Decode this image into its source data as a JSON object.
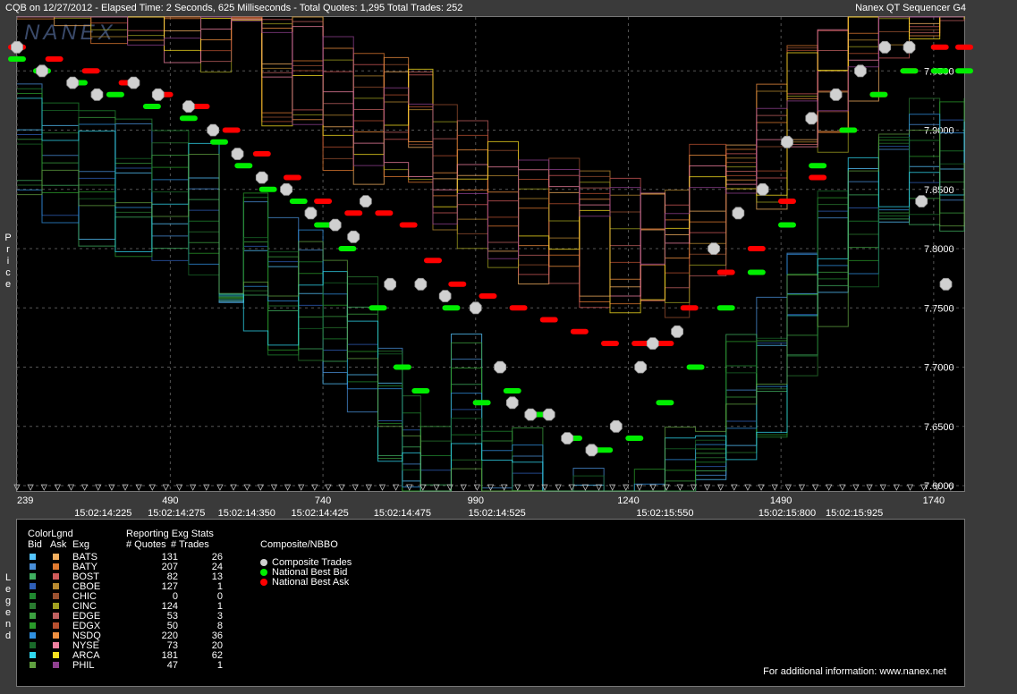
{
  "header": {
    "left": "CQB on 12/27/2012  -  Elapsed Time: 2 Seconds, 625 Milliseconds  -  Total Quotes: 1,295  Total Trades: 252",
    "right": "Nanex QT Sequencer G4"
  },
  "watermark": "NANEX",
  "side_labels": {
    "price": "Price",
    "legend": "Legend"
  },
  "chart_data": {
    "type": "scatter",
    "ylabel": "Price",
    "ylim": [
      7.5955,
      7.9955
    ],
    "xlim": [
      239,
      1790
    ],
    "y_ticks": [
      7.6,
      7.65,
      7.7,
      7.75,
      7.8,
      7.85,
      7.9,
      7.95
    ],
    "y_tick_labels": [
      "7.6000",
      "7.6500",
      "7.7000",
      "7.7500",
      "7.8000",
      "7.8500",
      "7.9000",
      "7.9500"
    ],
    "x_ticks": [
      239,
      490,
      740,
      990,
      1240,
      1490,
      1740
    ],
    "x_tick_labels": [
      "239",
      "490",
      "740",
      "990",
      "1240",
      "1490",
      "1740"
    ],
    "time_labels": [
      {
        "x": 380,
        "label": "15:02:14:225"
      },
      {
        "x": 500,
        "label": "15:02:14:275"
      },
      {
        "x": 615,
        "label": "15:02:14:350"
      },
      {
        "x": 735,
        "label": "15:02:14:425"
      },
      {
        "x": 870,
        "label": "15:02:14:475"
      },
      {
        "x": 1025,
        "label": "15:02:14:525"
      },
      {
        "x": 1300,
        "label": "15:02:15:550"
      },
      {
        "x": 1500,
        "label": "15:02:15:800"
      },
      {
        "x": 1610,
        "label": "15:02:15:925"
      }
    ],
    "grid": true,
    "series": [
      {
        "name": "Composite Trades",
        "color": "#d0d0d0",
        "x": [
          239,
          280,
          330,
          370,
          430,
          470,
          520,
          560,
          600,
          640,
          680,
          720,
          760,
          790,
          810,
          850,
          900,
          940,
          990,
          1030,
          1050,
          1080,
          1110,
          1140,
          1180,
          1220,
          1260,
          1280,
          1320,
          1380,
          1420,
          1460,
          1500,
          1540,
          1580,
          1620,
          1660,
          1700,
          1720,
          1760
        ],
        "y": [
          7.97,
          7.95,
          7.94,
          7.93,
          7.94,
          7.93,
          7.92,
          7.9,
          7.88,
          7.86,
          7.85,
          7.83,
          7.82,
          7.81,
          7.84,
          7.77,
          7.77,
          7.76,
          7.75,
          7.7,
          7.67,
          7.66,
          7.66,
          7.64,
          7.63,
          7.65,
          7.7,
          7.72,
          7.73,
          7.8,
          7.83,
          7.85,
          7.89,
          7.91,
          7.93,
          7.95,
          7.97,
          7.97,
          7.84,
          7.77
        ]
      },
      {
        "name": "National Best Bid",
        "color": "#00ee00",
        "x": [
          239,
          280,
          340,
          400,
          460,
          520,
          570,
          610,
          650,
          700,
          740,
          780,
          830,
          870,
          900,
          950,
          1000,
          1050,
          1100,
          1150,
          1200,
          1250,
          1300,
          1350,
          1400,
          1450,
          1500,
          1550,
          1600,
          1650,
          1700,
          1750,
          1790
        ],
        "y": [
          7.96,
          7.95,
          7.94,
          7.93,
          7.92,
          7.91,
          7.89,
          7.87,
          7.85,
          7.84,
          7.82,
          7.8,
          7.75,
          7.7,
          7.68,
          7.75,
          7.67,
          7.68,
          7.66,
          7.64,
          7.63,
          7.64,
          7.67,
          7.7,
          7.75,
          7.78,
          7.82,
          7.87,
          7.9,
          7.93,
          7.95,
          7.95,
          7.95
        ]
      },
      {
        "name": "National Best Ask",
        "color": "#ff0000",
        "x": [
          239,
          300,
          360,
          420,
          480,
          540,
          590,
          640,
          690,
          740,
          790,
          840,
          880,
          920,
          960,
          1010,
          1060,
          1110,
          1160,
          1210,
          1260,
          1300,
          1340,
          1400,
          1450,
          1500,
          1550,
          1600,
          1650,
          1700,
          1750,
          1790
        ],
        "y": [
          7.97,
          7.96,
          7.95,
          7.94,
          7.93,
          7.92,
          7.9,
          7.88,
          7.86,
          7.84,
          7.83,
          7.83,
          7.82,
          7.79,
          7.77,
          7.76,
          7.75,
          7.74,
          7.73,
          7.72,
          7.72,
          7.72,
          7.75,
          7.78,
          7.8,
          7.84,
          7.86,
          7.9,
          7.93,
          7.95,
          7.97,
          7.97
        ]
      }
    ],
    "legend_placement": "bottom"
  },
  "legend": {
    "titles": {
      "colorlgnd": "ColorLgnd",
      "bid": "Bid",
      "ask": "Ask",
      "exg": "Exg",
      "reporting": "Reporting Exg Stats",
      "quotes": "# Quotes",
      "trades": "# Trades",
      "composite": "Composite/NBBO"
    },
    "exchanges": [
      {
        "name": "BATS",
        "bid": "#56c6ff",
        "ask": "#f4b060",
        "quotes": "131",
        "trades": "26"
      },
      {
        "name": "BATY",
        "bid": "#4a8fd8",
        "ask": "#e07a30",
        "quotes": "207",
        "trades": "24"
      },
      {
        "name": "BOST",
        "bid": "#40b060",
        "ask": "#d05a5a",
        "quotes": "82",
        "trades": "13"
      },
      {
        "name": "CBOE",
        "bid": "#2f5fb8",
        "ask": "#b88a30",
        "quotes": "127",
        "trades": "1"
      },
      {
        "name": "CHIC",
        "bid": "#208830",
        "ask": "#9a5030",
        "quotes": "0",
        "trades": "0"
      },
      {
        "name": "CINC",
        "bid": "#2a7a30",
        "ask": "#a0a020",
        "quotes": "124",
        "trades": "1"
      },
      {
        "name": "EDGE",
        "bid": "#3ca040",
        "ask": "#c06060",
        "quotes": "53",
        "trades": "3"
      },
      {
        "name": "EDGX",
        "bid": "#2a9a2a",
        "ask": "#b85030",
        "quotes": "50",
        "trades": "8"
      },
      {
        "name": "NSDQ",
        "bid": "#3090e0",
        "ask": "#f09040",
        "quotes": "220",
        "trades": "36"
      },
      {
        "name": "NYSE",
        "bid": "#1a6a2a",
        "ask": "#f080a0",
        "quotes": "73",
        "trades": "20"
      },
      {
        "name": "ARCA",
        "bid": "#30d8f0",
        "ask": "#f8e020",
        "quotes": "181",
        "trades": "62"
      },
      {
        "name": "PHIL",
        "bid": "#60a040",
        "ask": "#904090",
        "quotes": "47",
        "trades": "1"
      }
    ],
    "nbbo": [
      {
        "label": "Composite Trades",
        "color": "#d0d0d0"
      },
      {
        "label": "National Best Bid",
        "color": "#00ee00"
      },
      {
        "label": "National Best Ask",
        "color": "#ff0000"
      }
    ]
  },
  "footer": "For additional information: www.nanex.net"
}
